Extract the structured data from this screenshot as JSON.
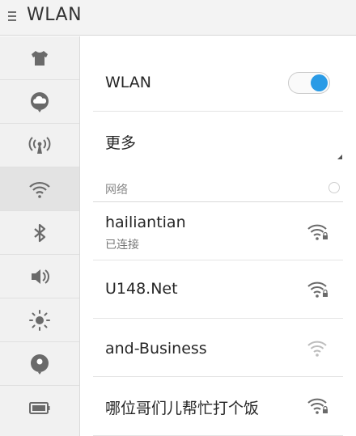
{
  "header": {
    "title": "WLAN"
  },
  "sidebar": {
    "items": [
      {
        "icon": "tshirt-icon"
      },
      {
        "icon": "cloud-icon"
      },
      {
        "icon": "hotspot-icon"
      },
      {
        "icon": "wifi-icon",
        "active": true
      },
      {
        "icon": "bluetooth-icon"
      },
      {
        "icon": "volume-icon"
      },
      {
        "icon": "brightness-icon"
      },
      {
        "icon": "location-icon"
      },
      {
        "icon": "battery-icon"
      }
    ]
  },
  "wlan": {
    "label": "WLAN",
    "enabled": true
  },
  "more": {
    "label": "更多"
  },
  "networks_section": {
    "label": "网络"
  },
  "networks": [
    {
      "ssid": "hailiantian",
      "status": "已连接",
      "secured": true
    },
    {
      "ssid": "U148.Net",
      "status": "",
      "secured": true
    },
    {
      "ssid": "and-Business",
      "status": "",
      "secured": false
    },
    {
      "ssid": "哪位哥们儿帮忙打个饭",
      "status": "",
      "secured": true
    }
  ],
  "colors": {
    "accent": "#2a9be6",
    "icon_gray": "#6a6a6a",
    "icon_light": "#bdbdbd"
  }
}
